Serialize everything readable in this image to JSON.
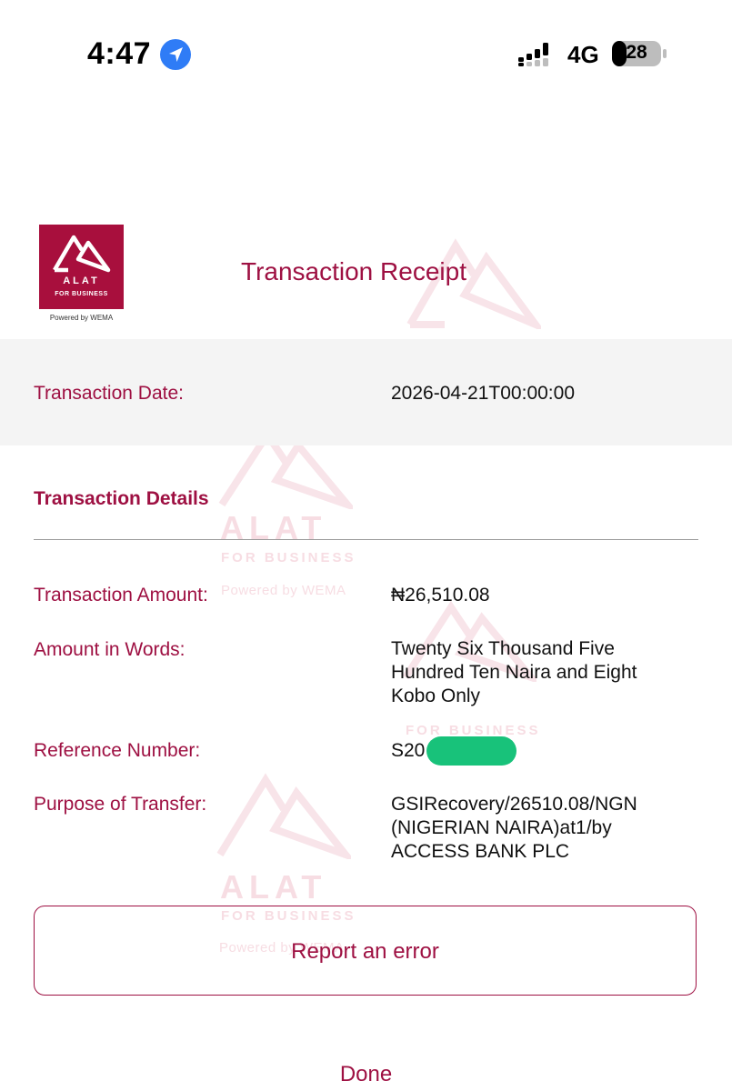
{
  "status_bar": {
    "time": "4:47",
    "network": "4G",
    "battery": "28",
    "icons": [
      "location-arrow-icon",
      "signal-bars-icon",
      "battery-icon"
    ]
  },
  "header": {
    "logo_word": "ALAT",
    "logo_sub": "FOR BUSINESS",
    "powered_by": "Powered by WEMA",
    "title": "Transaction Receipt"
  },
  "date_row": {
    "label": "Transaction Date:",
    "value": "2026-04-21T00:00:00"
  },
  "details": {
    "heading": "Transaction Details",
    "amount": {
      "label": "Transaction Amount:",
      "value": "₦26,510.08"
    },
    "words": {
      "label": "Amount in Words:",
      "lines": [
        "Twenty Six Thousand Five",
        "Hundred Ten Naira and  Eight",
        "Kobo Only"
      ]
    },
    "reference": {
      "label": "Reference Number:",
      "value": "S20"
    },
    "purpose": {
      "label": "Purpose of Transfer:",
      "lines": [
        "GSIRecovery/26510.08/NGN",
        "(NIGERIAN NAIRA)at1/by",
        "ACCESS BANK PLC"
      ]
    }
  },
  "watermark": {
    "word": "ALAT",
    "sub": "FOR BUSINESS",
    "powered": "Powered by WEMA"
  },
  "actions": {
    "report_label": "Report an error",
    "done_label": "Done"
  },
  "colors": {
    "brand": "#a80f3d",
    "text_accent": "#9e1042",
    "band": "#f4f4f4",
    "mask": "#18c27a"
  }
}
